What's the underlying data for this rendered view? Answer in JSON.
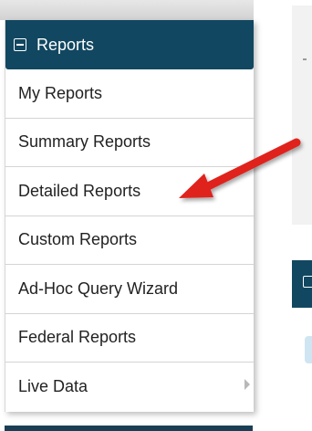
{
  "menu": {
    "header_label": "Reports",
    "items": [
      {
        "label": "My Reports",
        "has_submenu": false
      },
      {
        "label": "Summary Reports",
        "has_submenu": false
      },
      {
        "label": "Detailed Reports",
        "has_submenu": false
      },
      {
        "label": "Custom Reports",
        "has_submenu": false
      },
      {
        "label": "Ad-Hoc Query Wizard",
        "has_submenu": false
      },
      {
        "label": "Federal Reports",
        "has_submenu": false
      },
      {
        "label": "Live Data",
        "has_submenu": true
      }
    ]
  },
  "colors": {
    "header_bg": "#114760",
    "annotation_arrow": "#e0201c"
  },
  "icons": {
    "header_icon": "collapse-box-icon",
    "submenu_icon": "chevron-right-icon",
    "annotation": "red-arrow-icon"
  }
}
